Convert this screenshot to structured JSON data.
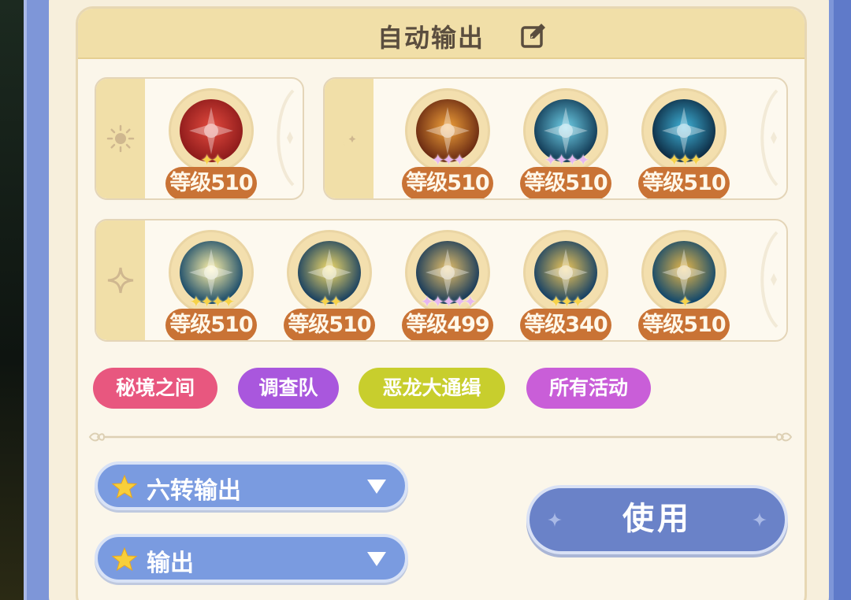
{
  "header": {
    "title": "自动输出",
    "edit_icon": "edit-icon"
  },
  "groups": [
    {
      "icon": "sun-icon",
      "skills": [
        {
          "name": "crimson-deer",
          "level_label": "等级510",
          "stars": 2,
          "star_color": "gold",
          "palette": [
            "#e34a3e",
            "#8e1b1b"
          ]
        }
      ]
    },
    {
      "icon": "moon-icon",
      "skills": [
        {
          "name": "fire-blast",
          "level_label": "等级510",
          "stars": 3,
          "star_color": "purple",
          "palette": [
            "#f2a23a",
            "#6a2a12"
          ]
        },
        {
          "name": "frost-claw",
          "level_label": "等级510",
          "stars": 4,
          "star_color": "purple",
          "palette": [
            "#6fd0e8",
            "#123a55"
          ]
        },
        {
          "name": "shadow-guardian",
          "level_label": "等级510",
          "stars": 3,
          "star_color": "gold",
          "palette": [
            "#3fb3d9",
            "#0d2c44"
          ]
        }
      ]
    },
    {
      "icon": "sparkle-icon",
      "skills": [
        {
          "name": "radiant-burst",
          "level_label": "等级510",
          "stars": 4,
          "star_color": "gold",
          "palette": [
            "#fff2a8",
            "#1b4c6a"
          ]
        },
        {
          "name": "starlight-bloom",
          "level_label": "等级510",
          "stars": 2,
          "star_color": "gold",
          "palette": [
            "#f5dd6a",
            "#1a4160"
          ]
        },
        {
          "name": "hammer-strike",
          "level_label": "等级499",
          "stars": 5,
          "star_color": "purple",
          "palette": [
            "#e8c16a",
            "#173a5a"
          ]
        },
        {
          "name": "thunder-fist",
          "level_label": "等级340",
          "stars": 3,
          "star_color": "gold",
          "palette": [
            "#f0c85a",
            "#154064"
          ]
        },
        {
          "name": "golden-wave",
          "level_label": "等级510",
          "stars": 1,
          "star_color": "gold",
          "palette": [
            "#e9b94a",
            "#12486b"
          ]
        }
      ]
    }
  ],
  "tags": [
    {
      "label": "秘境之间",
      "color": "#e8577f"
    },
    {
      "label": "调查队",
      "color": "#a957dd"
    },
    {
      "label": "恶龙大通缉",
      "color": "#c8ce2d"
    },
    {
      "label": "所有活动",
      "color": "#c95ed8"
    }
  ],
  "dropdowns": [
    {
      "label": "六转输出"
    },
    {
      "label": "输出"
    }
  ],
  "use_button": {
    "label": "使用"
  },
  "colors": {
    "panel_bg": "#fbf6ea",
    "header_bg": "#f1dfa8",
    "badge": "#c97335",
    "dropdown": "#7a9be0",
    "button": "#6a82c8"
  }
}
